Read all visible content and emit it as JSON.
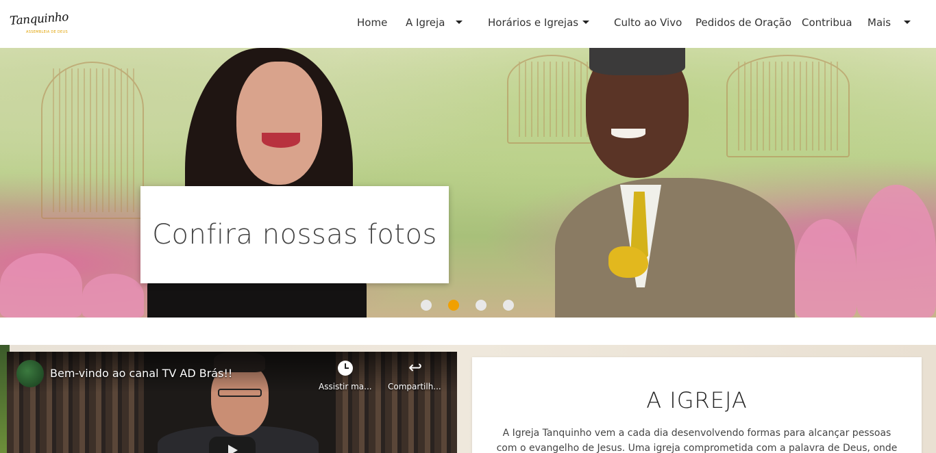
{
  "brand": {
    "name": "Tanquinho",
    "tagline": "ASSEMBLEIA DE DEUS"
  },
  "nav": {
    "items": [
      {
        "label": "Home"
      },
      {
        "label": "A Igreja"
      },
      {
        "label": "Horários e Igrejas"
      },
      {
        "label": "Culto ao Vivo"
      },
      {
        "label": "Pedidos de Oração"
      },
      {
        "label": "Contribua"
      },
      {
        "label": "Mais"
      }
    ]
  },
  "hero": {
    "caption": "Confira nossas fotos",
    "slides_total": 4,
    "active_slide": 2
  },
  "video": {
    "title": "Bem-vindo ao canal TV AD Brás!!",
    "watch_later_label": "Assistir ma...",
    "share_label": "Compartilh..."
  },
  "about": {
    "title": "A IGREJA",
    "text": "A Igreja Tanquinho vem a cada dia desenvolvendo formas para alcançar pessoas com o evangelho de Jesus. Uma igreja comprometida com a palavra de Deus, onde você é bem"
  },
  "colors": {
    "accent": "#f0a000",
    "logo_sub": "#e0a100"
  }
}
